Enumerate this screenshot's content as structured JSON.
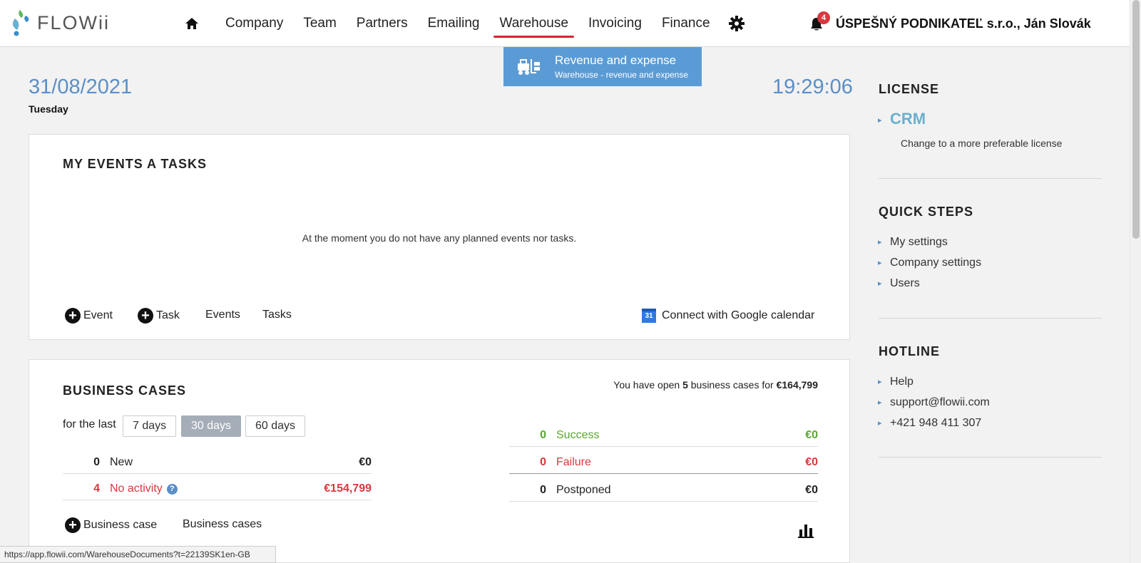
{
  "header": {
    "logo_text": "FLOWii",
    "nav": [
      "Company",
      "Team",
      "Partners",
      "Emailing",
      "Warehouse",
      "Invoicing",
      "Finance"
    ],
    "active_nav": "Warehouse",
    "notification_count": "4",
    "company_name": "ÚSPEŠNÝ PODNIKATEĽ s.r.o., Ján Slovák"
  },
  "dropdown": {
    "title": "Revenue and expense",
    "subtitle": "Warehouse - revenue and expense"
  },
  "date": "31/08/2021",
  "weekday": "Tuesday",
  "time": "19:29:06",
  "events_panel": {
    "title": "MY EVENTS A TASKS",
    "empty_message": "At the moment you do not have any planned events nor tasks.",
    "actions": {
      "add_event": "Event",
      "add_task": "Task",
      "events": "Events",
      "tasks": "Tasks"
    },
    "google_icon_text": "31",
    "google_calendar": "Connect with Google calendar"
  },
  "cases_panel": {
    "title": "BUSINESS CASES",
    "summary_prefix": "You have open ",
    "summary_count": "5",
    "summary_mid": " business cases for ",
    "summary_amount": "€164,799",
    "for_the_last": "for the last",
    "ranges": [
      "7 days",
      "30 days",
      "60 days"
    ],
    "active_range": "30 days",
    "left_rows": [
      {
        "count": "0",
        "label": "New",
        "amount": "€0"
      },
      {
        "count": "4",
        "label": "No activity",
        "amount": "€154,799"
      }
    ],
    "right_rows": [
      {
        "count": "0",
        "label": "Success",
        "amount": "€0"
      },
      {
        "count": "0",
        "label": "Failure",
        "amount": "€0"
      },
      {
        "count": "0",
        "label": "Postponed",
        "amount": "€0"
      }
    ],
    "add_case": "Business case",
    "cases_link": "Business cases"
  },
  "sidebar": {
    "license": {
      "heading": "LICENSE",
      "plan": "CRM",
      "change": "Change to a more preferable license"
    },
    "quick_steps": {
      "heading": "QUICK STEPS",
      "items": [
        "My settings",
        "Company settings",
        "Users"
      ]
    },
    "hotline": {
      "heading": "HOTLINE",
      "items": [
        "Help",
        "support@flowii.com",
        "+421 948 411 307"
      ]
    }
  },
  "status_url": "https://app.flowii.com/WarehouseDocuments?t=22139SK1en-GB",
  "colors": {
    "accent_blue": "#5b9bd5",
    "active_red": "#d0262d",
    "success_green": "#5aa832",
    "danger_red": "#d9383f"
  }
}
